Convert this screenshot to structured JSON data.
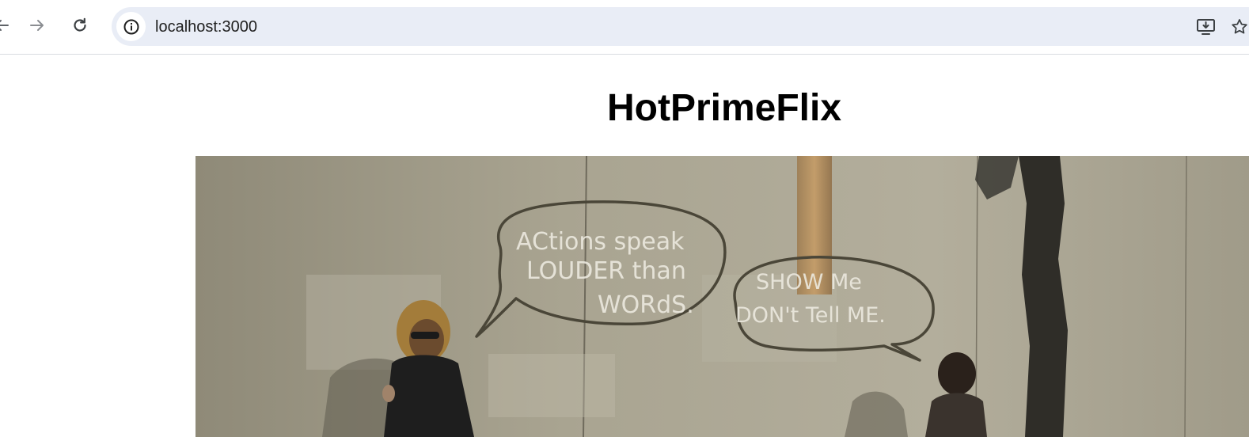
{
  "browser": {
    "url": "localhost:3000",
    "icons": {
      "back": "arrow-left-icon",
      "forward": "arrow-right-icon",
      "reload": "reload-icon",
      "site_info": "info-icon",
      "install": "install-app-icon",
      "bookmark": "star-icon"
    }
  },
  "page": {
    "title": "HotPrimeFlix",
    "video": {
      "graffiti_left": [
        "ACtions speak",
        "LOUDER than",
        "WORdS."
      ],
      "graffiti_right": [
        "SHOW Me",
        "DON't Tell ME."
      ]
    }
  },
  "colors": {
    "toolbar_bg": "#ffffff",
    "omnibox_bg": "#e9edf6",
    "title_text": "#000000",
    "wall": "#a7a18f"
  }
}
